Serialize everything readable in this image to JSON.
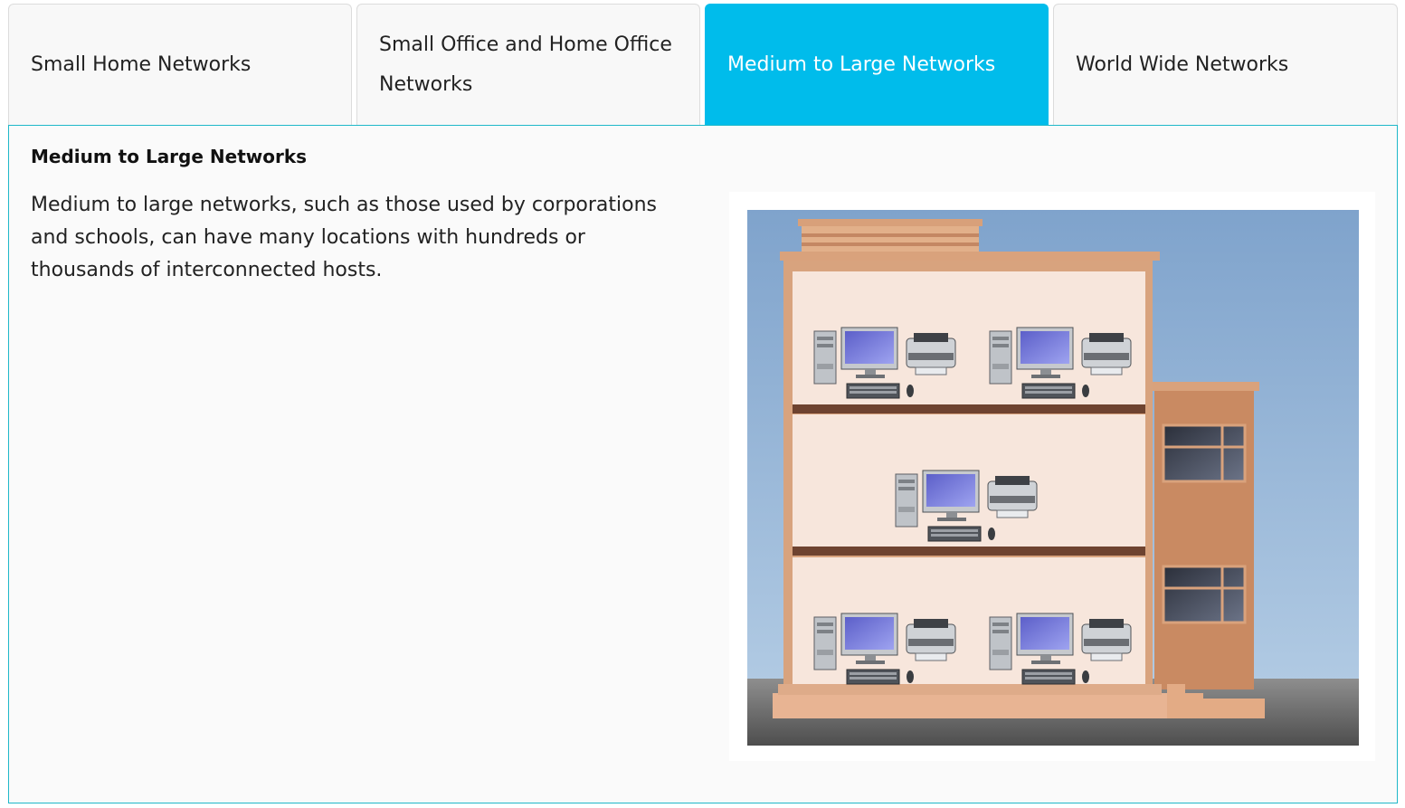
{
  "tabs": [
    {
      "label": "Small Home Networks",
      "active": false
    },
    {
      "label": "Small Office and Home Office Networks",
      "active": false
    },
    {
      "label": "Medium to Large Networks",
      "active": true
    },
    {
      "label": "World Wide Networks",
      "active": false
    }
  ],
  "panel": {
    "title": "Medium to Large Networks",
    "body": "Medium to large networks, such as those used by corporations and schools, can have many locations with hundreds or thousands of interconnected hosts."
  },
  "illustration": {
    "subject": "building-with-networked-computers",
    "colors": {
      "accent": "#00bceb",
      "border": "#1fb8c9",
      "sky": "#8eb3d6",
      "building": "#d9a57c",
      "interior": "#f7e6dc",
      "floor": "#6e4330"
    }
  }
}
